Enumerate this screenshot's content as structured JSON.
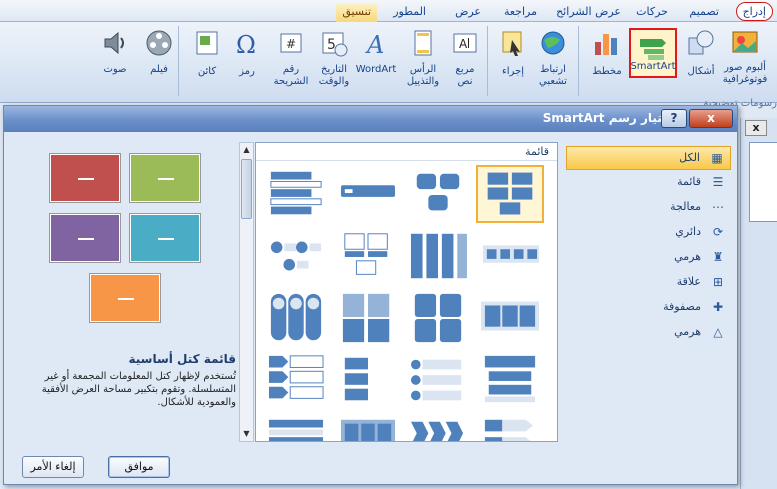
{
  "ribbon": {
    "tabs": [
      {
        "label": "إدراج",
        "active": true
      },
      {
        "label": "تصميم"
      },
      {
        "label": "حركات"
      },
      {
        "label": "عرض الشرائح"
      },
      {
        "label": "مراجعة"
      },
      {
        "label": "عرض"
      },
      {
        "label": "المطور"
      },
      {
        "label": "تنسيق",
        "contextual": true
      }
    ],
    "buttons": {
      "photo_album": "ألبوم صور",
      "photo_album_2": "فوتوغرافية",
      "shapes": "أشكال",
      "smartart": "SmartArt",
      "chart": "مخطط",
      "link": "ارتباط",
      "link_2": "تشعبي",
      "action": "إجراء",
      "textbox": "مربع",
      "textbox_2": "نص",
      "header_footer": "الرأس",
      "header_footer_2": "والتذييل",
      "wordart": "WordArt",
      "date_time": "التاريخ",
      "date_time_2": "والوقت",
      "slide_number": "رقم",
      "slide_number_2": "الشريحة",
      "symbol": "رمز",
      "object": "كائن",
      "movie": "فيلم",
      "sound": "صوت"
    },
    "group_labels": {
      "illustrations": "رسومات توضيحية"
    }
  },
  "dialog": {
    "title": "اختيار رسم SmartArt",
    "help": "?",
    "close": "x",
    "categories": [
      {
        "label": "الكل",
        "icon": "all-icon",
        "glyph": "▦",
        "selected": true
      },
      {
        "label": "قائمة",
        "icon": "list-icon",
        "glyph": "☰"
      },
      {
        "label": "معالجة",
        "icon": "process-icon",
        "glyph": "⋯"
      },
      {
        "label": "دائري",
        "icon": "cycle-icon",
        "glyph": "⟳"
      },
      {
        "label": "هرمي",
        "icon": "hierarchy-icon",
        "glyph": "♜"
      },
      {
        "label": "علاقة",
        "icon": "relationship-icon",
        "glyph": "⊞"
      },
      {
        "label": "مصفوفة",
        "icon": "matrix-icon",
        "glyph": "✚"
      },
      {
        "label": "هرمي",
        "icon": "pyramid-icon",
        "glyph": "△"
      }
    ],
    "gallery_header": "قائمة",
    "preview": {
      "title": "قائمة كتل أساسية",
      "description": "تُستخدم لإظهار كتل المعلومات المجمعة أو غير المتسلسلة. وتقوم بتكبير مساحة العرض الأفقية والعمودية للأشكال.",
      "colors": [
        "#c0504d",
        "#9bbb59",
        "#8064a2",
        "#4bacc6",
        "#f79646"
      ]
    },
    "ok": "موافق",
    "cancel": "إلغاء الأمر"
  },
  "colors": {
    "accent": "#4f81bd",
    "highlight": "#e01a1a",
    "selection": "#f9c84b"
  }
}
